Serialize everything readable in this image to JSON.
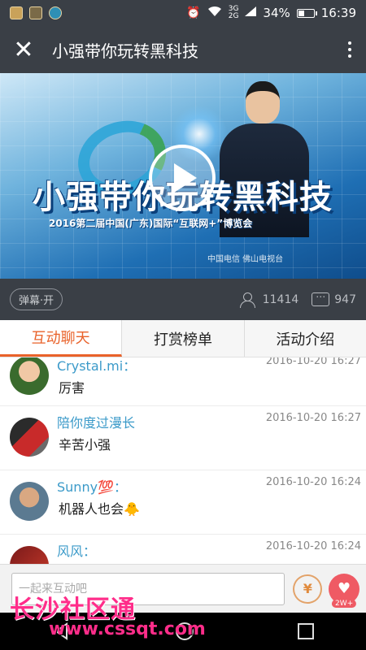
{
  "status_bar": {
    "battery": "34%",
    "battery_level": 0.34,
    "time": "16:39",
    "net_top": "3G",
    "net_bottom": "2G",
    "icons": [
      "app-icon-1",
      "app-icon-2",
      "app-icon-3",
      "alarm-icon",
      "wifi-icon",
      "signal-icon",
      "battery-icon"
    ]
  },
  "title_bar": {
    "title": "小强带你玩转黑科技",
    "close_icon": "close-icon",
    "more_icon": "more-vertical-icon"
  },
  "video": {
    "title": "小强带你玩转黑科技",
    "subtitle": "2016第二届中国(广东)国际“互联网+”博览会",
    "sponsors": "中国电信  佛山电视台",
    "play_icon": "play-icon"
  },
  "info_bar": {
    "danmu_label": "弹幕·开",
    "viewers": "11414",
    "comments": "947"
  },
  "tabs": [
    {
      "label": "互动聊天",
      "active": true
    },
    {
      "label": "打赏榜单",
      "active": false
    },
    {
      "label": "活动介绍",
      "active": false
    }
  ],
  "messages": [
    {
      "name": "Crystal.mi：",
      "time": "2016-10-20 16:27",
      "text": "厉害"
    },
    {
      "name": "陪你度过漫长",
      "time": "2016-10-20 16:27",
      "text": "辛苦小强"
    },
    {
      "name": "Sunny💯：",
      "time": "2016-10-20 16:24",
      "text": "机器人也会🐥"
    },
    {
      "name": "风风：",
      "time": "2016-10-20 16:24",
      "text": ""
    }
  ],
  "input_bar": {
    "placeholder": "一起来互动吧",
    "gift_label": "¥",
    "like_count": "2W+"
  },
  "watermark": {
    "title": "长沙社区通",
    "url": "www.cssqt.com"
  },
  "colors": {
    "header_bg": "#3a3f46",
    "accent": "#e9622a",
    "name_blue": "#3b9ac9",
    "like_red": "#ef5a64",
    "watermark": "#ff2d8a"
  }
}
